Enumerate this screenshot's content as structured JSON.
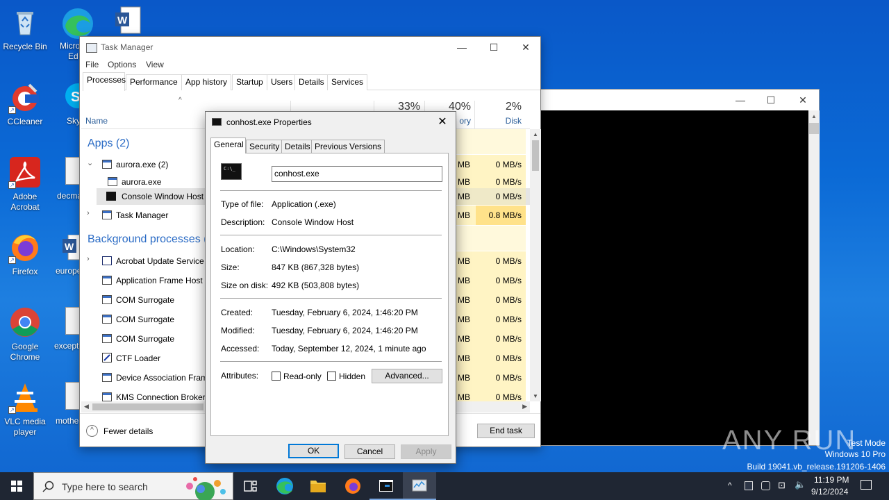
{
  "desktop": {
    "icons": [
      {
        "label": "Recycle Bin",
        "icon": "recycle-bin-icon"
      },
      {
        "label": "CCleaner",
        "icon": "ccleaner-icon"
      },
      {
        "label": "Adobe\nAcrobat",
        "icon": "acrobat-icon"
      },
      {
        "label": "Firefox",
        "icon": "firefox-icon"
      },
      {
        "label": "Google\nChrome",
        "icon": "chrome-icon"
      },
      {
        "label": "VLC media\nplayer",
        "icon": "vlc-icon"
      }
    ],
    "partial_labels": [
      "Micro",
      "Ed",
      "Sky",
      "decma",
      "europe",
      "excepti",
      "mothe"
    ]
  },
  "task_manager": {
    "title": "Task Manager",
    "menu": [
      "File",
      "Options",
      "View"
    ],
    "tabs": [
      "Processes",
      "Performance",
      "App history",
      "Startup",
      "Users",
      "Details",
      "Services"
    ],
    "active_tab": "Processes",
    "columns": {
      "name": "Name",
      "memory_pct": "40%",
      "memory_label": "ory",
      "disk_pct": "2%",
      "disk_label": "Disk",
      "cpu_pct": "33%"
    },
    "groups": {
      "apps": "Apps (2)",
      "background": "Background processes (2"
    },
    "rows": [
      {
        "name": "aurora.exe (2)",
        "mem": "MB",
        "disk": "0 MB/s"
      },
      {
        "name": "aurora.exe",
        "mem": "MB",
        "disk": "0 MB/s"
      },
      {
        "name": "Console Window Host",
        "mem": "MB",
        "disk": "0 MB/s"
      },
      {
        "name": "Task Manager",
        "mem": "MB",
        "disk": "0.8 MB/s"
      },
      {
        "name": "Acrobat Update Service (",
        "mem": "MB",
        "disk": "0 MB/s"
      },
      {
        "name": "Application Frame Host",
        "mem": "MB",
        "disk": "0 MB/s"
      },
      {
        "name": "COM Surrogate",
        "mem": "MB",
        "disk": "0 MB/s"
      },
      {
        "name": "COM Surrogate",
        "mem": "MB",
        "disk": "0 MB/s"
      },
      {
        "name": "COM Surrogate",
        "mem": "MB",
        "disk": "0 MB/s"
      },
      {
        "name": "CTF Loader",
        "mem": "MB",
        "disk": "0 MB/s"
      },
      {
        "name": "Device Association Fram",
        "mem": "MB",
        "disk": "0 MB/s"
      },
      {
        "name": "KMS Connection Broker",
        "mem": "MB",
        "disk": "0 MB/s"
      }
    ],
    "fewer_details": "Fewer details",
    "end_task": "End task"
  },
  "properties": {
    "title": "conhost.exe Properties",
    "tabs": [
      "General",
      "Security",
      "Details",
      "Previous Versions"
    ],
    "filename": "conhost.exe",
    "type_label": "Type of file:",
    "type_value": "Application (.exe)",
    "desc_label": "Description:",
    "desc_value": "Console Window Host",
    "location_label": "Location:",
    "location_value": "C:\\Windows\\System32",
    "size_label": "Size:",
    "size_value": "847 KB (867,328 bytes)",
    "sizeondisk_label": "Size on disk:",
    "sizeondisk_value": "492 KB (503,808 bytes)",
    "created_label": "Created:",
    "created_value": "Tuesday, February 6, 2024, 1:46:20 PM",
    "modified_label": "Modified:",
    "modified_value": "Tuesday, February 6, 2024, 1:46:20 PM",
    "accessed_label": "Accessed:",
    "accessed_value": "Today, September 12, 2024, 1 minute ago",
    "attributes_label": "Attributes:",
    "readonly_label": "Read-only",
    "hidden_label": "Hidden",
    "advanced_label": "Advanced...",
    "ok_label": "OK",
    "cancel_label": "Cancel",
    "apply_label": "Apply"
  },
  "taskbar": {
    "search_placeholder": "Type here to search",
    "time": "11:19 PM",
    "date": "9/12/2024"
  },
  "watermark": {
    "line1": "Test Mode",
    "line2": "Windows 10 Pro",
    "line3": "Build 19041.vb_release.191206-1406",
    "brand": "ANY RUN"
  }
}
